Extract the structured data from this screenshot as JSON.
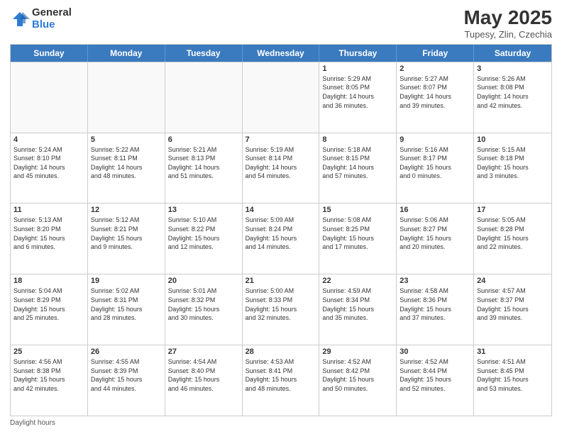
{
  "logo": {
    "general": "General",
    "blue": "Blue"
  },
  "title": "May 2025",
  "subtitle": "Tupesy, Zlin, Czechia",
  "days": [
    "Sunday",
    "Monday",
    "Tuesday",
    "Wednesday",
    "Thursday",
    "Friday",
    "Saturday"
  ],
  "weeks": [
    [
      {
        "num": "",
        "text": "",
        "empty": true
      },
      {
        "num": "",
        "text": "",
        "empty": true
      },
      {
        "num": "",
        "text": "",
        "empty": true
      },
      {
        "num": "",
        "text": "",
        "empty": true
      },
      {
        "num": "1",
        "text": "Sunrise: 5:29 AM\nSunset: 8:05 PM\nDaylight: 14 hours\nand 36 minutes."
      },
      {
        "num": "2",
        "text": "Sunrise: 5:27 AM\nSunset: 8:07 PM\nDaylight: 14 hours\nand 39 minutes."
      },
      {
        "num": "3",
        "text": "Sunrise: 5:26 AM\nSunset: 8:08 PM\nDaylight: 14 hours\nand 42 minutes."
      }
    ],
    [
      {
        "num": "4",
        "text": "Sunrise: 5:24 AM\nSunset: 8:10 PM\nDaylight: 14 hours\nand 45 minutes."
      },
      {
        "num": "5",
        "text": "Sunrise: 5:22 AM\nSunset: 8:11 PM\nDaylight: 14 hours\nand 48 minutes."
      },
      {
        "num": "6",
        "text": "Sunrise: 5:21 AM\nSunset: 8:13 PM\nDaylight: 14 hours\nand 51 minutes."
      },
      {
        "num": "7",
        "text": "Sunrise: 5:19 AM\nSunset: 8:14 PM\nDaylight: 14 hours\nand 54 minutes."
      },
      {
        "num": "8",
        "text": "Sunrise: 5:18 AM\nSunset: 8:15 PM\nDaylight: 14 hours\nand 57 minutes."
      },
      {
        "num": "9",
        "text": "Sunrise: 5:16 AM\nSunset: 8:17 PM\nDaylight: 15 hours\nand 0 minutes."
      },
      {
        "num": "10",
        "text": "Sunrise: 5:15 AM\nSunset: 8:18 PM\nDaylight: 15 hours\nand 3 minutes."
      }
    ],
    [
      {
        "num": "11",
        "text": "Sunrise: 5:13 AM\nSunset: 8:20 PM\nDaylight: 15 hours\nand 6 minutes."
      },
      {
        "num": "12",
        "text": "Sunrise: 5:12 AM\nSunset: 8:21 PM\nDaylight: 15 hours\nand 9 minutes."
      },
      {
        "num": "13",
        "text": "Sunrise: 5:10 AM\nSunset: 8:22 PM\nDaylight: 15 hours\nand 12 minutes."
      },
      {
        "num": "14",
        "text": "Sunrise: 5:09 AM\nSunset: 8:24 PM\nDaylight: 15 hours\nand 14 minutes."
      },
      {
        "num": "15",
        "text": "Sunrise: 5:08 AM\nSunset: 8:25 PM\nDaylight: 15 hours\nand 17 minutes."
      },
      {
        "num": "16",
        "text": "Sunrise: 5:06 AM\nSunset: 8:27 PM\nDaylight: 15 hours\nand 20 minutes."
      },
      {
        "num": "17",
        "text": "Sunrise: 5:05 AM\nSunset: 8:28 PM\nDaylight: 15 hours\nand 22 minutes."
      }
    ],
    [
      {
        "num": "18",
        "text": "Sunrise: 5:04 AM\nSunset: 8:29 PM\nDaylight: 15 hours\nand 25 minutes."
      },
      {
        "num": "19",
        "text": "Sunrise: 5:02 AM\nSunset: 8:31 PM\nDaylight: 15 hours\nand 28 minutes."
      },
      {
        "num": "20",
        "text": "Sunrise: 5:01 AM\nSunset: 8:32 PM\nDaylight: 15 hours\nand 30 minutes."
      },
      {
        "num": "21",
        "text": "Sunrise: 5:00 AM\nSunset: 8:33 PM\nDaylight: 15 hours\nand 32 minutes."
      },
      {
        "num": "22",
        "text": "Sunrise: 4:59 AM\nSunset: 8:34 PM\nDaylight: 15 hours\nand 35 minutes."
      },
      {
        "num": "23",
        "text": "Sunrise: 4:58 AM\nSunset: 8:36 PM\nDaylight: 15 hours\nand 37 minutes."
      },
      {
        "num": "24",
        "text": "Sunrise: 4:57 AM\nSunset: 8:37 PM\nDaylight: 15 hours\nand 39 minutes."
      }
    ],
    [
      {
        "num": "25",
        "text": "Sunrise: 4:56 AM\nSunset: 8:38 PM\nDaylight: 15 hours\nand 42 minutes."
      },
      {
        "num": "26",
        "text": "Sunrise: 4:55 AM\nSunset: 8:39 PM\nDaylight: 15 hours\nand 44 minutes."
      },
      {
        "num": "27",
        "text": "Sunrise: 4:54 AM\nSunset: 8:40 PM\nDaylight: 15 hours\nand 46 minutes."
      },
      {
        "num": "28",
        "text": "Sunrise: 4:53 AM\nSunset: 8:41 PM\nDaylight: 15 hours\nand 48 minutes."
      },
      {
        "num": "29",
        "text": "Sunrise: 4:52 AM\nSunset: 8:42 PM\nDaylight: 15 hours\nand 50 minutes."
      },
      {
        "num": "30",
        "text": "Sunrise: 4:52 AM\nSunset: 8:44 PM\nDaylight: 15 hours\nand 52 minutes."
      },
      {
        "num": "31",
        "text": "Sunrise: 4:51 AM\nSunset: 8:45 PM\nDaylight: 15 hours\nand 53 minutes."
      }
    ]
  ],
  "footer": "Daylight hours"
}
